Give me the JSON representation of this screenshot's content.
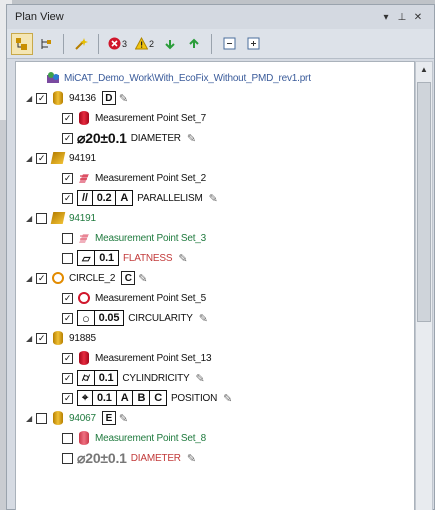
{
  "window": {
    "title": "Plan View",
    "controls": {
      "dropdown": "▾",
      "pin": "⊥",
      "close": "✕"
    }
  },
  "toolbar": {
    "error_count": "3",
    "warning_count": "2"
  },
  "tree": {
    "root_label": "MiCAT_Demo_Work\\With_EcoFix_Without_PMD_rev1.prt",
    "rows": [
      {
        "label": "94136",
        "datum": "D"
      },
      {
        "label": "Measurement Point Set_7"
      },
      {
        "fcf": [
          "⌀20±0.1"
        ],
        "label": "DIAMETER"
      },
      {
        "label": "94191"
      },
      {
        "label": "Measurement Point Set_2"
      },
      {
        "fcf": [
          "//",
          "0.2",
          "A"
        ],
        "label": "PARALLELISM"
      },
      {
        "label": "94191"
      },
      {
        "label": "Measurement Point Set_3"
      },
      {
        "fcf": [
          "▱",
          "0.1"
        ],
        "label": "FLATNESS"
      },
      {
        "label": "CIRCLE_2",
        "datum": "C"
      },
      {
        "label": "Measurement Point Set_5"
      },
      {
        "fcf": [
          "○",
          "0.05"
        ],
        "label": "CIRCULARITY"
      },
      {
        "label": "91885"
      },
      {
        "label": "Measurement Point Set_13"
      },
      {
        "fcf": [
          "⌭",
          "0.1"
        ],
        "label": "CYLINDRICITY"
      },
      {
        "fcf": [
          "⌖",
          "0.1",
          "A",
          "B",
          "C"
        ],
        "label": "POSITION"
      },
      {
        "label": "94067",
        "datum": "E"
      },
      {
        "label": "Measurement Point Set_8"
      },
      {
        "fcf": [
          "⌀20±0.1"
        ],
        "label": "DIAMETER"
      }
    ]
  },
  "colors": {
    "accent_disabled_text": "#1f7a3e",
    "gold": "#f0c035",
    "red": "#d0162b"
  }
}
